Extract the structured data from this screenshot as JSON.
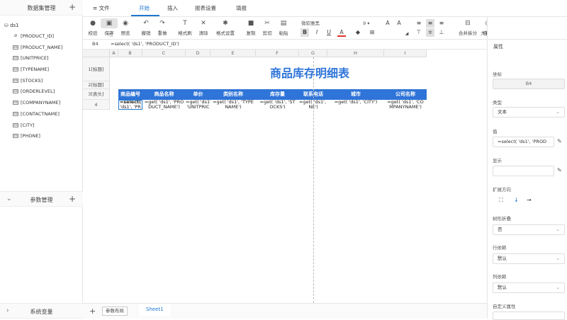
{
  "left": {
    "dataset_panel_title": "数据集管理",
    "tree_root": "ds1",
    "fields": [
      "[PRODUCT_ID]",
      "[PRODUCT_NAME]",
      "[UNITPRICE]",
      "[TYPENAME]",
      "[STOCKS]",
      "[ORDERLEVEL]",
      "[COMPANYNAME]",
      "[CONTACTNAME]",
      "[CITY]",
      "[PHONE]"
    ],
    "param_panel_title": "参数管理",
    "sysvar_panel_title": "系统变量"
  },
  "topbar": {
    "file_label": "文件",
    "tabs": [
      "开始",
      "插入",
      "报表设置",
      "填报"
    ],
    "active_tab": "开始"
  },
  "toolbar": {
    "buttons": [
      "校验",
      "保存",
      "预览",
      "撤销",
      "重做",
      "格式刷",
      "清除",
      "格式设置",
      "复制",
      "剪切",
      "粘贴"
    ],
    "font_name": "微软雅黑",
    "font_size": "9",
    "right_buttons": [
      "合并拆分",
      "大数据",
      "自适应与冻结"
    ]
  },
  "formula_bar": {
    "cell_ref": "B4",
    "formula": "=select( 'ds1', 'PRODUCT_ID')"
  },
  "sheet": {
    "columns": [
      "A",
      "B",
      "C",
      "D",
      "E",
      "F",
      "G",
      "H",
      "I"
    ],
    "rows": [
      "1[标题]",
      "2[标题]",
      "3[表头]",
      "4"
    ],
    "report_title": "商品库存明细表",
    "headers": [
      "商品编号",
      "商品名称",
      "单价",
      "类别名称",
      "库存量",
      "联系电话",
      "城市",
      "公司名称"
    ],
    "data_row": [
      {
        "l1": "=select(",
        "l2": "'ds1', 'PR"
      },
      {
        "l1": "=get( 'ds1', 'PRO",
        "l2": "DUCT_NAME')"
      },
      {
        "l1": "=get( 'ds1',",
        "l2": "'UNITPRIC"
      },
      {
        "l1": "=get( 'ds1', 'TYPE",
        "l2": "NAME')"
      },
      {
        "l1": "=get( 'ds1', 'ST",
        "l2": "OCKS')"
      },
      {
        "l1": "=get( 'ds1', 'PHO",
        "l2": "NE')"
      },
      {
        "l1": "=get( 'ds1', 'CITY')",
        "l2": ""
      },
      {
        "l1": "=get( 'ds1', 'CO",
        "l2": "MPANYNAME')"
      }
    ]
  },
  "right": {
    "panel_title": "属性",
    "coord_label": "坐标",
    "coord_value": "B4",
    "type_label": "类型",
    "type_value": "文本",
    "value_label": "值",
    "value_value": "=select( 'ds1', 'PROD",
    "display_label": "显示",
    "display_value": "",
    "expand_label": "扩展方向",
    "expand_icons": [
      "⛶",
      "↓",
      "→"
    ],
    "tree_collapse_label": "树形折叠",
    "tree_collapse_value": "否",
    "row_dep_label": "行依赖",
    "row_dep_value": "默认",
    "col_dep_label": "列依赖",
    "col_dep_value": "默认",
    "custom_attr_label": "自定义属性"
  },
  "bottom": {
    "param_layout": "参数布局",
    "sheet_name": "Sheet1"
  },
  "colors": {
    "accent": "#1f78d1",
    "header_fill": "#2f74d8",
    "title": "#2f74d8"
  }
}
